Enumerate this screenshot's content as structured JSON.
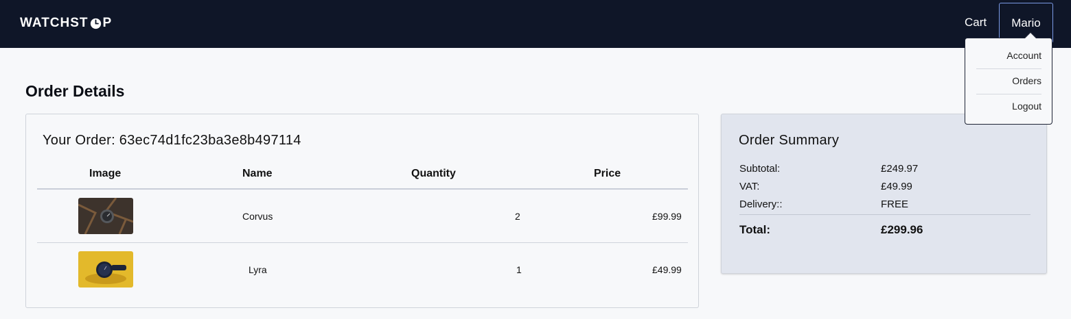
{
  "nav": {
    "logo_pre": "WATCHST",
    "logo_post": "P",
    "cart_label": "Cart",
    "user_label": "Mario"
  },
  "dropdown": {
    "items": [
      "Account",
      "Orders",
      "Logout"
    ]
  },
  "page_title": "Order Details",
  "order": {
    "heading": "Your Order: 63ec74d1fc23ba3e8b497114",
    "columns": [
      "Image",
      "Name",
      "Quantity",
      "Price"
    ],
    "rows": [
      {
        "name": "Corvus",
        "quantity": "2",
        "price": "£99.99",
        "image": "corvus-watch-thumbnail"
      },
      {
        "name": "Lyra",
        "quantity": "1",
        "price": "£49.99",
        "image": "lyra-watch-thumbnail"
      }
    ]
  },
  "summary": {
    "title": "Order Summary",
    "subtotal_label": "Subtotal:",
    "subtotal_value": "£249.97",
    "vat_label": "VAT:",
    "vat_value": "£49.99",
    "delivery_label": "Delivery::",
    "delivery_value": "FREE",
    "total_label": "Total:",
    "total_value": "£299.96"
  },
  "colors": {
    "navbar_bg": "#0f1628",
    "page_bg": "#f7f8fa",
    "summary_bg": "#e1e5ee",
    "user_button_border": "#7b9ae6"
  }
}
